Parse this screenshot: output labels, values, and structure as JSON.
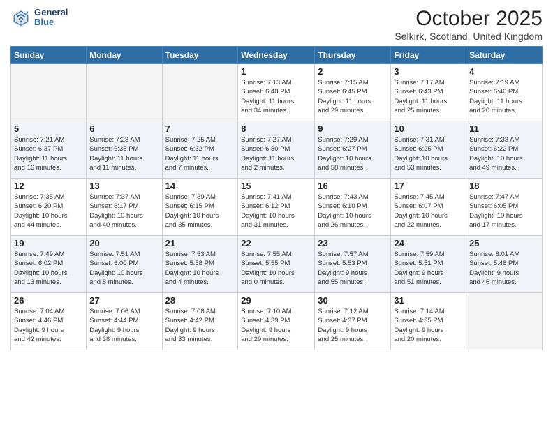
{
  "header": {
    "logo_general": "General",
    "logo_blue": "Blue",
    "month_title": "October 2025",
    "location": "Selkirk, Scotland, United Kingdom"
  },
  "days_of_week": [
    "Sunday",
    "Monday",
    "Tuesday",
    "Wednesday",
    "Thursday",
    "Friday",
    "Saturday"
  ],
  "weeks": [
    [
      {
        "day": "",
        "info": ""
      },
      {
        "day": "",
        "info": ""
      },
      {
        "day": "",
        "info": ""
      },
      {
        "day": "1",
        "info": "Sunrise: 7:13 AM\nSunset: 6:48 PM\nDaylight: 11 hours\nand 34 minutes."
      },
      {
        "day": "2",
        "info": "Sunrise: 7:15 AM\nSunset: 6:45 PM\nDaylight: 11 hours\nand 29 minutes."
      },
      {
        "day": "3",
        "info": "Sunrise: 7:17 AM\nSunset: 6:43 PM\nDaylight: 11 hours\nand 25 minutes."
      },
      {
        "day": "4",
        "info": "Sunrise: 7:19 AM\nSunset: 6:40 PM\nDaylight: 11 hours\nand 20 minutes."
      }
    ],
    [
      {
        "day": "5",
        "info": "Sunrise: 7:21 AM\nSunset: 6:37 PM\nDaylight: 11 hours\nand 16 minutes."
      },
      {
        "day": "6",
        "info": "Sunrise: 7:23 AM\nSunset: 6:35 PM\nDaylight: 11 hours\nand 11 minutes."
      },
      {
        "day": "7",
        "info": "Sunrise: 7:25 AM\nSunset: 6:32 PM\nDaylight: 11 hours\nand 7 minutes."
      },
      {
        "day": "8",
        "info": "Sunrise: 7:27 AM\nSunset: 6:30 PM\nDaylight: 11 hours\nand 2 minutes."
      },
      {
        "day": "9",
        "info": "Sunrise: 7:29 AM\nSunset: 6:27 PM\nDaylight: 10 hours\nand 58 minutes."
      },
      {
        "day": "10",
        "info": "Sunrise: 7:31 AM\nSunset: 6:25 PM\nDaylight: 10 hours\nand 53 minutes."
      },
      {
        "day": "11",
        "info": "Sunrise: 7:33 AM\nSunset: 6:22 PM\nDaylight: 10 hours\nand 49 minutes."
      }
    ],
    [
      {
        "day": "12",
        "info": "Sunrise: 7:35 AM\nSunset: 6:20 PM\nDaylight: 10 hours\nand 44 minutes."
      },
      {
        "day": "13",
        "info": "Sunrise: 7:37 AM\nSunset: 6:17 PM\nDaylight: 10 hours\nand 40 minutes."
      },
      {
        "day": "14",
        "info": "Sunrise: 7:39 AM\nSunset: 6:15 PM\nDaylight: 10 hours\nand 35 minutes."
      },
      {
        "day": "15",
        "info": "Sunrise: 7:41 AM\nSunset: 6:12 PM\nDaylight: 10 hours\nand 31 minutes."
      },
      {
        "day": "16",
        "info": "Sunrise: 7:43 AM\nSunset: 6:10 PM\nDaylight: 10 hours\nand 26 minutes."
      },
      {
        "day": "17",
        "info": "Sunrise: 7:45 AM\nSunset: 6:07 PM\nDaylight: 10 hours\nand 22 minutes."
      },
      {
        "day": "18",
        "info": "Sunrise: 7:47 AM\nSunset: 6:05 PM\nDaylight: 10 hours\nand 17 minutes."
      }
    ],
    [
      {
        "day": "19",
        "info": "Sunrise: 7:49 AM\nSunset: 6:02 PM\nDaylight: 10 hours\nand 13 minutes."
      },
      {
        "day": "20",
        "info": "Sunrise: 7:51 AM\nSunset: 6:00 PM\nDaylight: 10 hours\nand 8 minutes."
      },
      {
        "day": "21",
        "info": "Sunrise: 7:53 AM\nSunset: 5:58 PM\nDaylight: 10 hours\nand 4 minutes."
      },
      {
        "day": "22",
        "info": "Sunrise: 7:55 AM\nSunset: 5:55 PM\nDaylight: 10 hours\nand 0 minutes."
      },
      {
        "day": "23",
        "info": "Sunrise: 7:57 AM\nSunset: 5:53 PM\nDaylight: 9 hours\nand 55 minutes."
      },
      {
        "day": "24",
        "info": "Sunrise: 7:59 AM\nSunset: 5:51 PM\nDaylight: 9 hours\nand 51 minutes."
      },
      {
        "day": "25",
        "info": "Sunrise: 8:01 AM\nSunset: 5:48 PM\nDaylight: 9 hours\nand 46 minutes."
      }
    ],
    [
      {
        "day": "26",
        "info": "Sunrise: 7:04 AM\nSunset: 4:46 PM\nDaylight: 9 hours\nand 42 minutes."
      },
      {
        "day": "27",
        "info": "Sunrise: 7:06 AM\nSunset: 4:44 PM\nDaylight: 9 hours\nand 38 minutes."
      },
      {
        "day": "28",
        "info": "Sunrise: 7:08 AM\nSunset: 4:42 PM\nDaylight: 9 hours\nand 33 minutes."
      },
      {
        "day": "29",
        "info": "Sunrise: 7:10 AM\nSunset: 4:39 PM\nDaylight: 9 hours\nand 29 minutes."
      },
      {
        "day": "30",
        "info": "Sunrise: 7:12 AM\nSunset: 4:37 PM\nDaylight: 9 hours\nand 25 minutes."
      },
      {
        "day": "31",
        "info": "Sunrise: 7:14 AM\nSunset: 4:35 PM\nDaylight: 9 hours\nand 20 minutes."
      },
      {
        "day": "",
        "info": ""
      }
    ]
  ]
}
